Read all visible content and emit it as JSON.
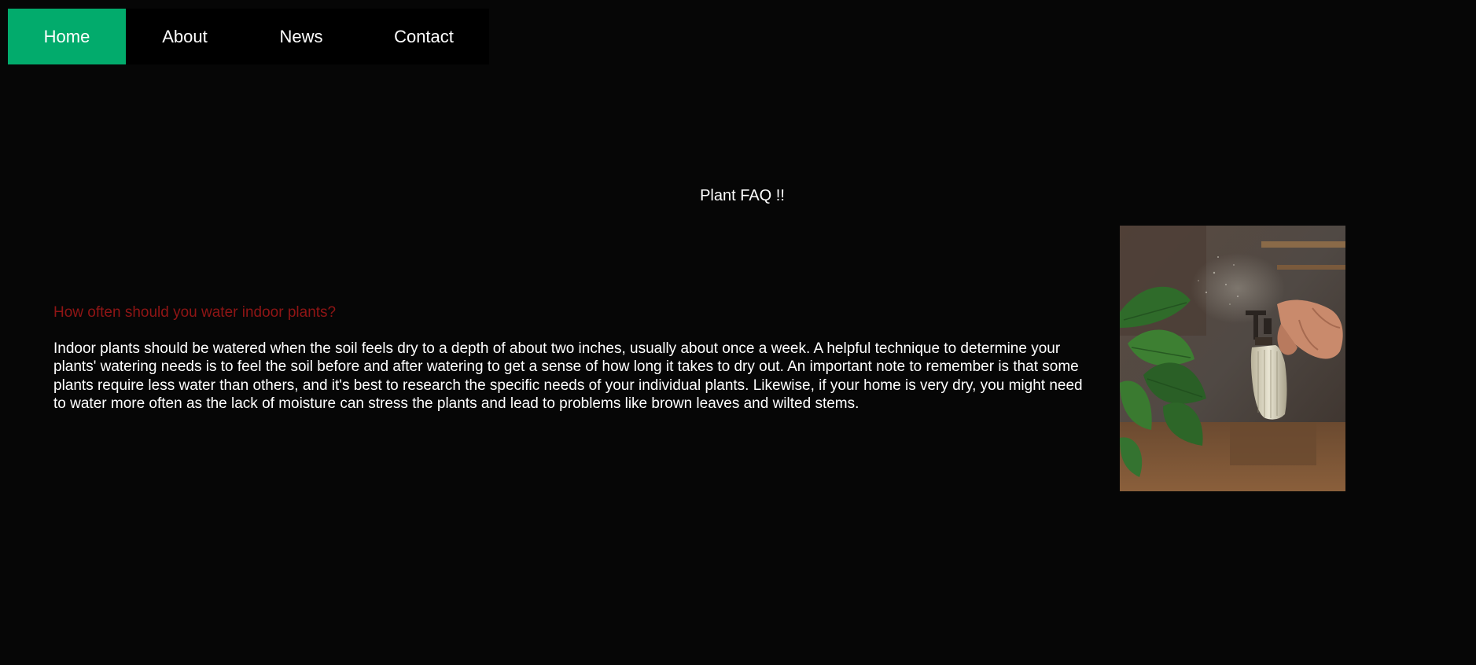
{
  "nav": {
    "items": [
      {
        "label": "Home",
        "active": true
      },
      {
        "label": "About",
        "active": false
      },
      {
        "label": "News",
        "active": false
      },
      {
        "label": "Contact",
        "active": false
      }
    ],
    "active_color": "#02ab6c"
  },
  "main": {
    "title": "Plant FAQ !!",
    "question": "How often should you water indoor plants?",
    "answer": "Indoor plants should be watered when the soil feels dry to a depth of about two inches, usually about once a week. A helpful technique to determine your plants' watering needs is to feel the soil before and after watering to get a sense of how long it takes to dry out. An important note to remember is that some plants require less water than others, and it's best to research the specific needs of your individual plants. Likewise, if your home is very dry, you might need to water more often as the lack of moisture can stress the plants and lead to problems like brown leaves and wilted stems."
  },
  "colors": {
    "background": "#060606",
    "question": "#8f1515",
    "text": "#ffffff"
  }
}
